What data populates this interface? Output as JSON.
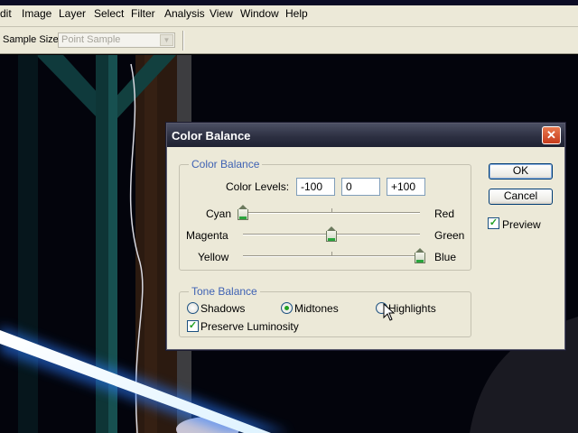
{
  "menubar": {
    "items": [
      "dit",
      "Image",
      "Layer",
      "Select",
      "Filter",
      "Analysis",
      "View",
      "Window",
      "Help"
    ]
  },
  "options_bar": {
    "sample_size_label": "Sample Size:",
    "sample_size_value": "Point Sample"
  },
  "dialog": {
    "title": "Color Balance",
    "close_glyph": "✕",
    "color_balance": {
      "group_title": "Color Balance",
      "levels_label": "Color Levels:",
      "levels": [
        "-100",
        "0",
        "+100"
      ],
      "sliders": [
        {
          "left": "Cyan",
          "right": "Red",
          "value": -100
        },
        {
          "left": "Magenta",
          "right": "Green",
          "value": 0
        },
        {
          "left": "Yellow",
          "right": "Blue",
          "value": 100
        }
      ]
    },
    "tone_balance": {
      "group_title": "Tone Balance",
      "shadows": "Shadows",
      "midtones": "Midtones",
      "highlights": "Highlights",
      "selected": "Midtones",
      "preserve_luminosity": "Preserve Luminosity",
      "preserve_luminosity_checked": true
    },
    "buttons": {
      "ok": "OK",
      "cancel": "Cancel"
    },
    "preview": {
      "label": "Preview",
      "checked": true
    },
    "check_glyph": "✓"
  },
  "colors": {
    "accent_group_title": "#3f62b3",
    "titlebar_dark": "#2d3042",
    "close_button": "#d5522a",
    "thumb_green": "#29a53c"
  }
}
